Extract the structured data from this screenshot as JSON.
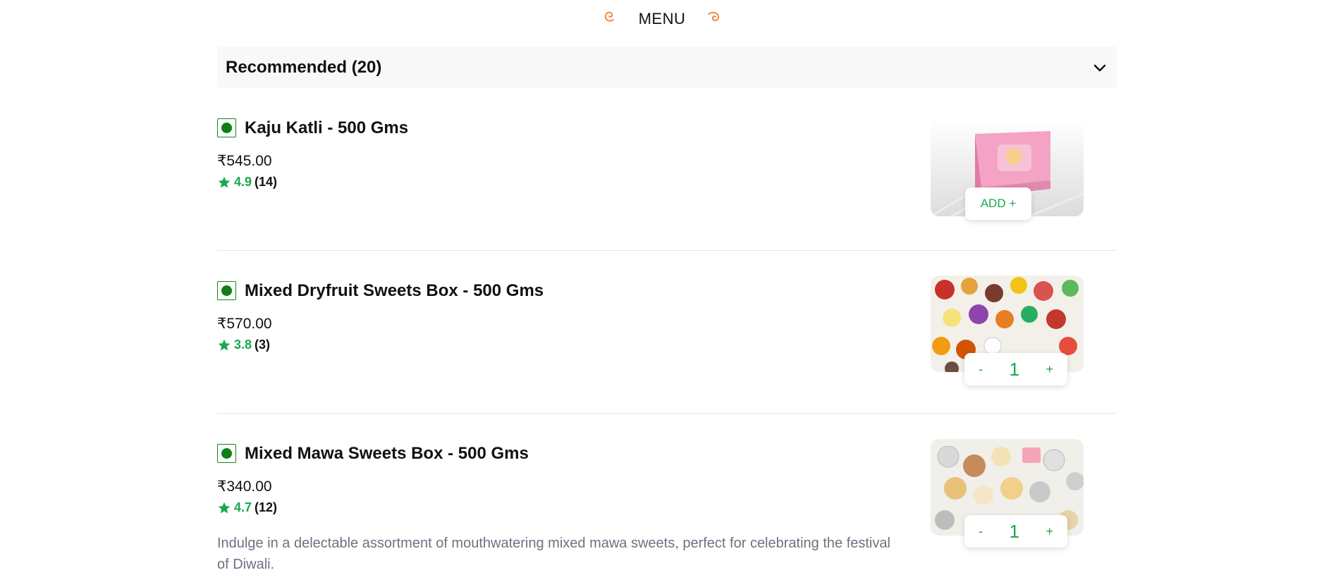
{
  "header": {
    "title": "MENU"
  },
  "section": {
    "title": "Recommended (20)"
  },
  "items": [
    {
      "name": "Kaju Katli - 500 Gms",
      "price": "₹545.00",
      "rating": "4.9",
      "rating_count": "(14)",
      "action": "ADD +"
    },
    {
      "name": "Mixed Dryfruit Sweets Box - 500 Gms",
      "price": "₹570.00",
      "rating": "3.8",
      "rating_count": "(3)",
      "quantity": "1",
      "minus_label": "-",
      "plus_label": "+"
    },
    {
      "name": "Mixed Mawa Sweets Box - 500 Gms",
      "price": "₹340.00",
      "rating": "4.7",
      "rating_count": "(12)",
      "quantity": "1",
      "minus_label": "-",
      "plus_label": "+",
      "description": "Indulge in a delectable assortment of mouthwatering mixed mawa sweets, perfect for celebrating the festival of Diwali."
    }
  ],
  "colors": {
    "veg_green": "#0f7f13",
    "rating_green": "#1ba94c",
    "accent_orange": "#f07c2a"
  }
}
